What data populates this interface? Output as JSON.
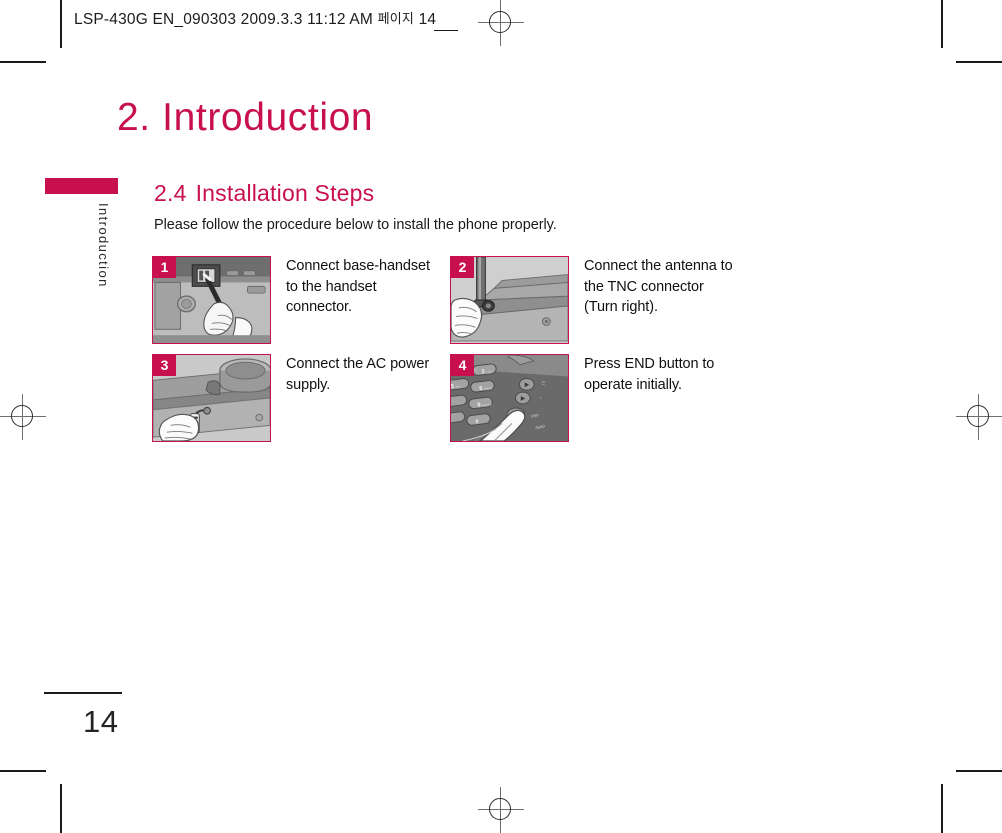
{
  "prepress": {
    "slug_main": "LSP-430G EN_090303  2009.3.3 11:12 AM",
    "slug_korean": "페이지",
    "slug_page": "14"
  },
  "chapter": {
    "title": "2. Introduction"
  },
  "side_tab": {
    "label": "Introduction",
    "color": "#c8104e"
  },
  "section": {
    "number": "2.4",
    "title": "Installation Steps",
    "intro": "Please follow the procedure below to install the phone properly."
  },
  "steps": [
    {
      "number": "1",
      "caption": "Connect base-handset to the handset connector.",
      "illustration": "handset-connector-illustration"
    },
    {
      "number": "2",
      "caption": "Connect the antenna to the TNC connector (Turn right).",
      "illustration": "antenna-tnc-illustration"
    },
    {
      "number": "3",
      "caption": "Connect the AC power supply.",
      "illustration": "ac-power-illustration"
    },
    {
      "number": "4",
      "caption": "Press END button to operate initially.",
      "illustration": "keypad-end-button-illustration"
    }
  ],
  "footer": {
    "page_number": "14"
  },
  "colors": {
    "brand": "#c8104e",
    "text": "#1a1a1a"
  }
}
